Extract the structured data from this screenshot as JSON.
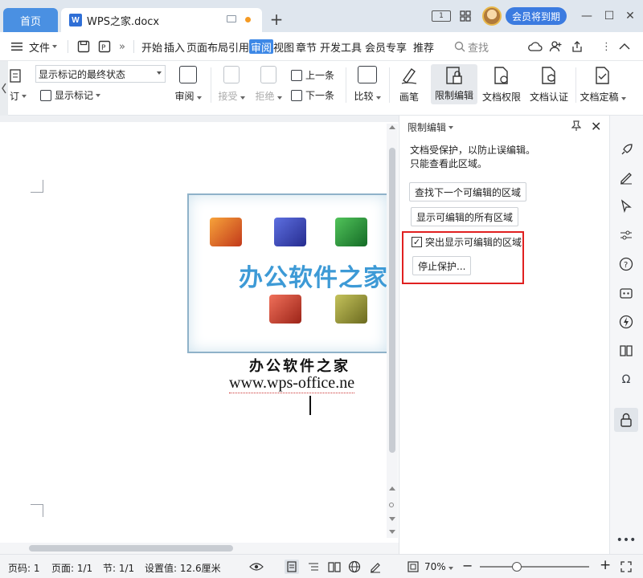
{
  "titlebar": {
    "home_tab": "首页",
    "doc_tab": "WPS之家.docx",
    "badge": "1",
    "vip_button": "会员将到期",
    "add_tab": "+",
    "minimize": "—",
    "maximize": "☐",
    "close": "✕"
  },
  "menubar": {
    "file_label": "文件",
    "items": [
      "开始",
      "插入",
      "页面布局",
      "引用",
      "审阅",
      "视图",
      "章节",
      "开发工具",
      "会员专享",
      "推荐"
    ],
    "active_item": "审阅",
    "search_label": "查找"
  },
  "ribbon": {
    "markup_select_value": "显示标记的最终状态",
    "track_label": "订",
    "show_markup_label": "显示标记",
    "review_label": "审阅",
    "accept_label": "接受",
    "reject_label": "拒绝",
    "prev_label": "上一条",
    "next_label": "下一条",
    "compare_label": "比较",
    "ink_label": "画笔",
    "restrict_label": "限制编辑",
    "permission_label": "文档权限",
    "certify_label": "文档认证",
    "finalize_label": "文档定稿"
  },
  "document": {
    "logo_text": "办公软件之家",
    "title": "办公软件之家",
    "url": "www.wps-office.ne"
  },
  "panel": {
    "title": "限制编辑",
    "desc_line1": "文档受保护，以防止误编辑。",
    "desc_line2": "只能查看此区域。",
    "find_next_button": "查找下一个可编辑的区域",
    "show_all_button": "显示可编辑的所有区域",
    "highlight_checkbox_label": "突出显示可编辑的区域",
    "highlight_checked": true,
    "stop_protect_button": "停止保护..."
  },
  "statusbar": {
    "page_number": "页码: 1",
    "page_count": "页面: 1/1",
    "section": "节: 1/1",
    "setting_value": "设置值: 12.6厘米",
    "zoom": "70%",
    "zoom_minus": "−",
    "zoom_plus": "+"
  },
  "colors": {
    "accent": "#3d88e6",
    "highlight_border": "#e02020",
    "vip_button": "#3b7be0"
  }
}
